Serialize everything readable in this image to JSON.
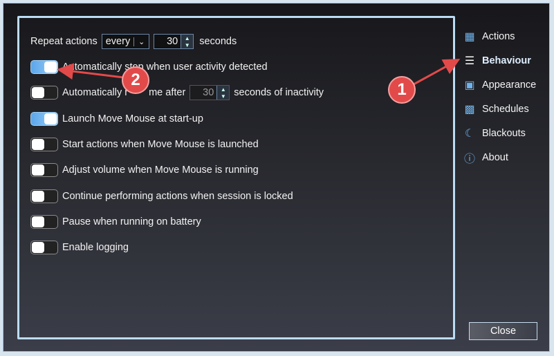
{
  "settings": {
    "repeat": {
      "label": "Repeat actions",
      "mode": "every",
      "value": "30",
      "unit": "seconds"
    },
    "toggles": [
      {
        "label": "Automatically stop when user activity detected",
        "on": true
      },
      {
        "label_pre": "Automatically r",
        "label_mid": "me after",
        "value": "30",
        "label_post": "seconds of inactivity",
        "on": false
      },
      {
        "label": "Launch Move Mouse at start-up",
        "on": true
      },
      {
        "label": "Start actions when Move Mouse is launched",
        "on": false
      },
      {
        "label": "Adjust volume when Move Mouse is running",
        "on": false
      },
      {
        "label": "Continue performing actions when session is locked",
        "on": false
      },
      {
        "label": "Pause when running on battery",
        "on": false
      },
      {
        "label": "Enable logging",
        "on": false
      }
    ]
  },
  "nav": [
    {
      "label": "Actions",
      "icon": "list-icon"
    },
    {
      "label": "Behaviour",
      "icon": "sliders-icon",
      "active": true
    },
    {
      "label": "Appearance",
      "icon": "window-icon"
    },
    {
      "label": "Schedules",
      "icon": "calendar-icon"
    },
    {
      "label": "Blackouts",
      "icon": "moon-icon"
    },
    {
      "label": "About",
      "icon": "info-icon"
    }
  ],
  "close_label": "Close",
  "annotations": [
    {
      "number": "1"
    },
    {
      "number": "2"
    }
  ],
  "colors": {
    "accent": "#6fb3ec",
    "annotation": "#e24a4a"
  }
}
